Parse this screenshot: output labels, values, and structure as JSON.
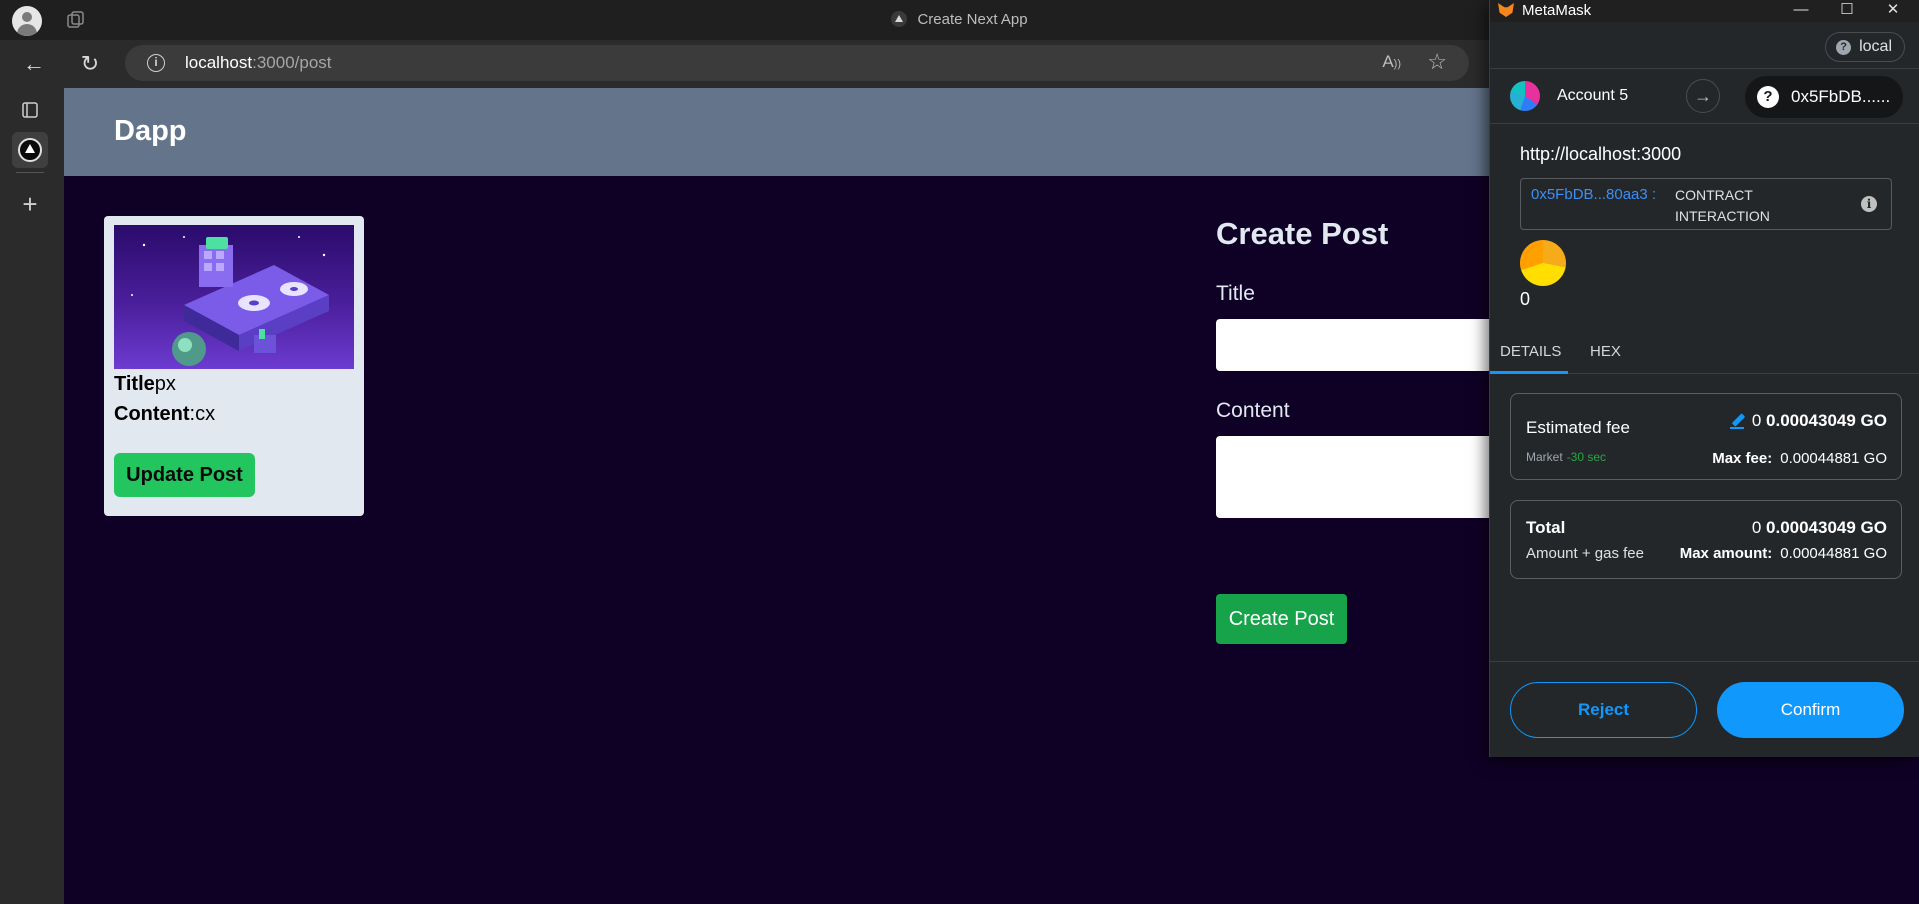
{
  "browser": {
    "window_title": "Create Next App",
    "url_host": "localhost",
    "url_path": ":3000/post",
    "read_aloud_label": "A",
    "favorite_icon": "star-icon"
  },
  "app": {
    "brand": "Dapp",
    "post": {
      "title_label": "Title",
      "title_value": "px",
      "content_label": "Content",
      "content_value": ":cx",
      "update_button": "Update Post"
    },
    "create": {
      "heading": "Create Post",
      "title_label": "Title",
      "content_label": "Content",
      "submit_button": "Create Post"
    }
  },
  "metamask": {
    "window_title": "MetaMask",
    "network": "local",
    "network_badge": "?",
    "account_name": "Account 5",
    "recipient": "0x5FbDB......",
    "recipient_badge": "?",
    "origin": "http://localhost:3000",
    "contract_address": "0x5FbDB...80aa3 :",
    "contract_kind": "CONTRACT INTERACTION",
    "amount": "0",
    "tabs": [
      "DETAILS",
      "HEX"
    ],
    "estimated_fee": {
      "label": "Estimated fee",
      "prefix": "0",
      "value": "0.00043049 GO",
      "market": "Market",
      "time": "-30 sec",
      "max_label": "Max fee:",
      "max_value": "0.00044881 GO"
    },
    "total": {
      "label": "Total",
      "sub": "Amount + gas fee",
      "prefix": "0",
      "value": "0.00043049 GO",
      "max_label": "Max amount:",
      "max_value": "0.00044881 GO"
    },
    "reject": "Reject",
    "confirm": "Confirm"
  }
}
